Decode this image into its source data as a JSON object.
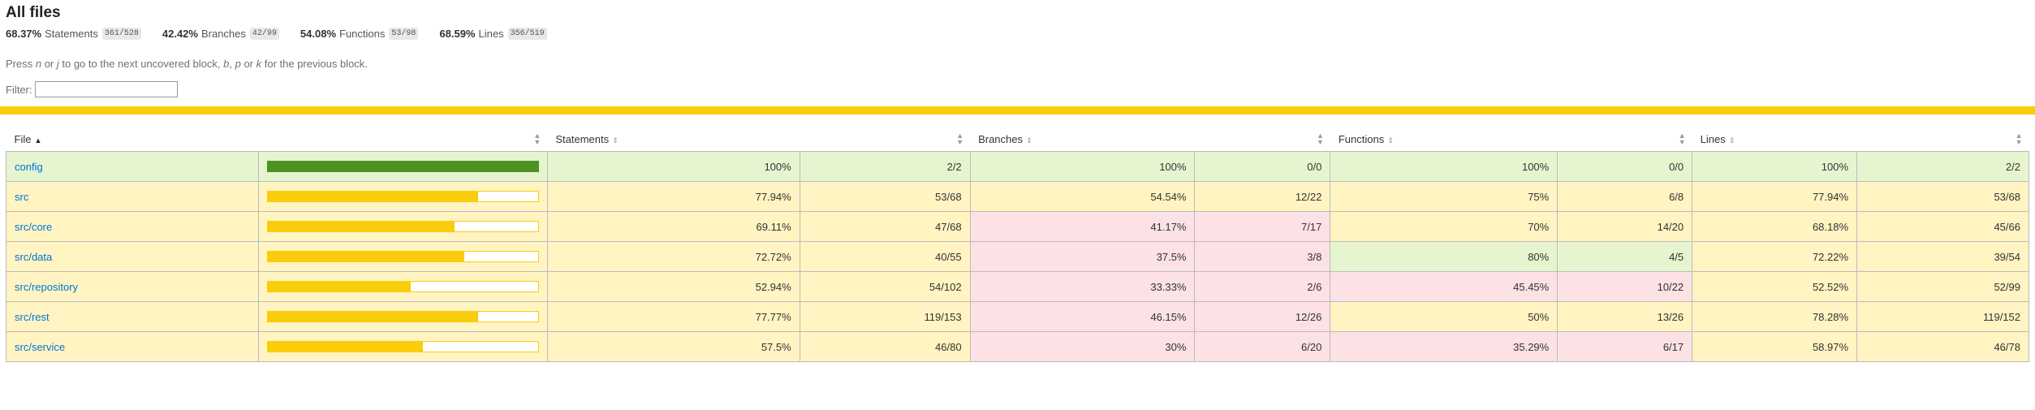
{
  "header": {
    "title": "All files"
  },
  "summary": [
    {
      "pct": "68.37%",
      "name": "Statements",
      "fraction": "361/528"
    },
    {
      "pct": "42.42%",
      "name": "Branches",
      "fraction": "42/99"
    },
    {
      "pct": "54.08%",
      "name": "Functions",
      "fraction": "53/98"
    },
    {
      "pct": "68.59%",
      "name": "Lines",
      "fraction": "356/519"
    }
  ],
  "hint": {
    "p1": "Press ",
    "k1": "n",
    "p2": " or ",
    "k2": "j",
    "p3": " to go to the next uncovered block, ",
    "k3": "b",
    "p4": ", ",
    "k4": "p",
    "p5": " or ",
    "k5": "k",
    "p6": " for the previous block."
  },
  "filter": {
    "label": "Filter:",
    "value": ""
  },
  "table": {
    "headers": {
      "file": "File",
      "bar": "",
      "statements": "Statements",
      "statements_fraction": "",
      "branches": "Branches",
      "branches_fraction": "",
      "functions": "Functions",
      "functions_fraction": "",
      "lines": "Lines",
      "lines_fraction": ""
    },
    "rows": [
      {
        "file": "config",
        "level": "high",
        "bar_percent": 100,
        "statements": {
          "pct": "100%",
          "fraction": "2/2",
          "level": "high"
        },
        "branches": {
          "pct": "100%",
          "fraction": "0/0",
          "level": "high"
        },
        "functions": {
          "pct": "100%",
          "fraction": "0/0",
          "level": "high"
        },
        "lines": {
          "pct": "100%",
          "fraction": "2/2",
          "level": "high"
        }
      },
      {
        "file": "src",
        "level": "medium",
        "bar_percent": 77.94,
        "statements": {
          "pct": "77.94%",
          "fraction": "53/68",
          "level": "medium"
        },
        "branches": {
          "pct": "54.54%",
          "fraction": "12/22",
          "level": "medium"
        },
        "functions": {
          "pct": "75%",
          "fraction": "6/8",
          "level": "medium"
        },
        "lines": {
          "pct": "77.94%",
          "fraction": "53/68",
          "level": "medium"
        }
      },
      {
        "file": "src/core",
        "level": "medium",
        "bar_percent": 69.11,
        "statements": {
          "pct": "69.11%",
          "fraction": "47/68",
          "level": "medium"
        },
        "branches": {
          "pct": "41.17%",
          "fraction": "7/17",
          "level": "low"
        },
        "functions": {
          "pct": "70%",
          "fraction": "14/20",
          "level": "medium"
        },
        "lines": {
          "pct": "68.18%",
          "fraction": "45/66",
          "level": "medium"
        }
      },
      {
        "file": "src/data",
        "level": "medium",
        "bar_percent": 72.72,
        "statements": {
          "pct": "72.72%",
          "fraction": "40/55",
          "level": "medium"
        },
        "branches": {
          "pct": "37.5%",
          "fraction": "3/8",
          "level": "low"
        },
        "functions": {
          "pct": "80%",
          "fraction": "4/5",
          "level": "high"
        },
        "lines": {
          "pct": "72.22%",
          "fraction": "39/54",
          "level": "medium"
        }
      },
      {
        "file": "src/repository",
        "level": "medium",
        "bar_percent": 52.94,
        "statements": {
          "pct": "52.94%",
          "fraction": "54/102",
          "level": "medium"
        },
        "branches": {
          "pct": "33.33%",
          "fraction": "2/6",
          "level": "low"
        },
        "functions": {
          "pct": "45.45%",
          "fraction": "10/22",
          "level": "low"
        },
        "lines": {
          "pct": "52.52%",
          "fraction": "52/99",
          "level": "medium"
        }
      },
      {
        "file": "src/rest",
        "level": "medium",
        "bar_percent": 77.77,
        "statements": {
          "pct": "77.77%",
          "fraction": "119/153",
          "level": "medium"
        },
        "branches": {
          "pct": "46.15%",
          "fraction": "12/26",
          "level": "low"
        },
        "functions": {
          "pct": "50%",
          "fraction": "13/26",
          "level": "medium"
        },
        "lines": {
          "pct": "78.28%",
          "fraction": "119/152",
          "level": "medium"
        }
      },
      {
        "file": "src/service",
        "level": "medium",
        "bar_percent": 57.5,
        "statements": {
          "pct": "57.5%",
          "fraction": "46/80",
          "level": "medium"
        },
        "branches": {
          "pct": "30%",
          "fraction": "6/20",
          "level": "low"
        },
        "functions": {
          "pct": "35.29%",
          "fraction": "6/17",
          "level": "low"
        },
        "lines": {
          "pct": "58.97%",
          "fraction": "46/78",
          "level": "medium"
        }
      }
    ]
  },
  "colors": {
    "high": "#e6f5d0",
    "medium": "#fff4c2",
    "low": "#fce1e5",
    "bar_high": "#4d9221",
    "bar_medium": "#f9cd0b",
    "status_line": "#f9cd0b",
    "link": "#0074d9"
  }
}
